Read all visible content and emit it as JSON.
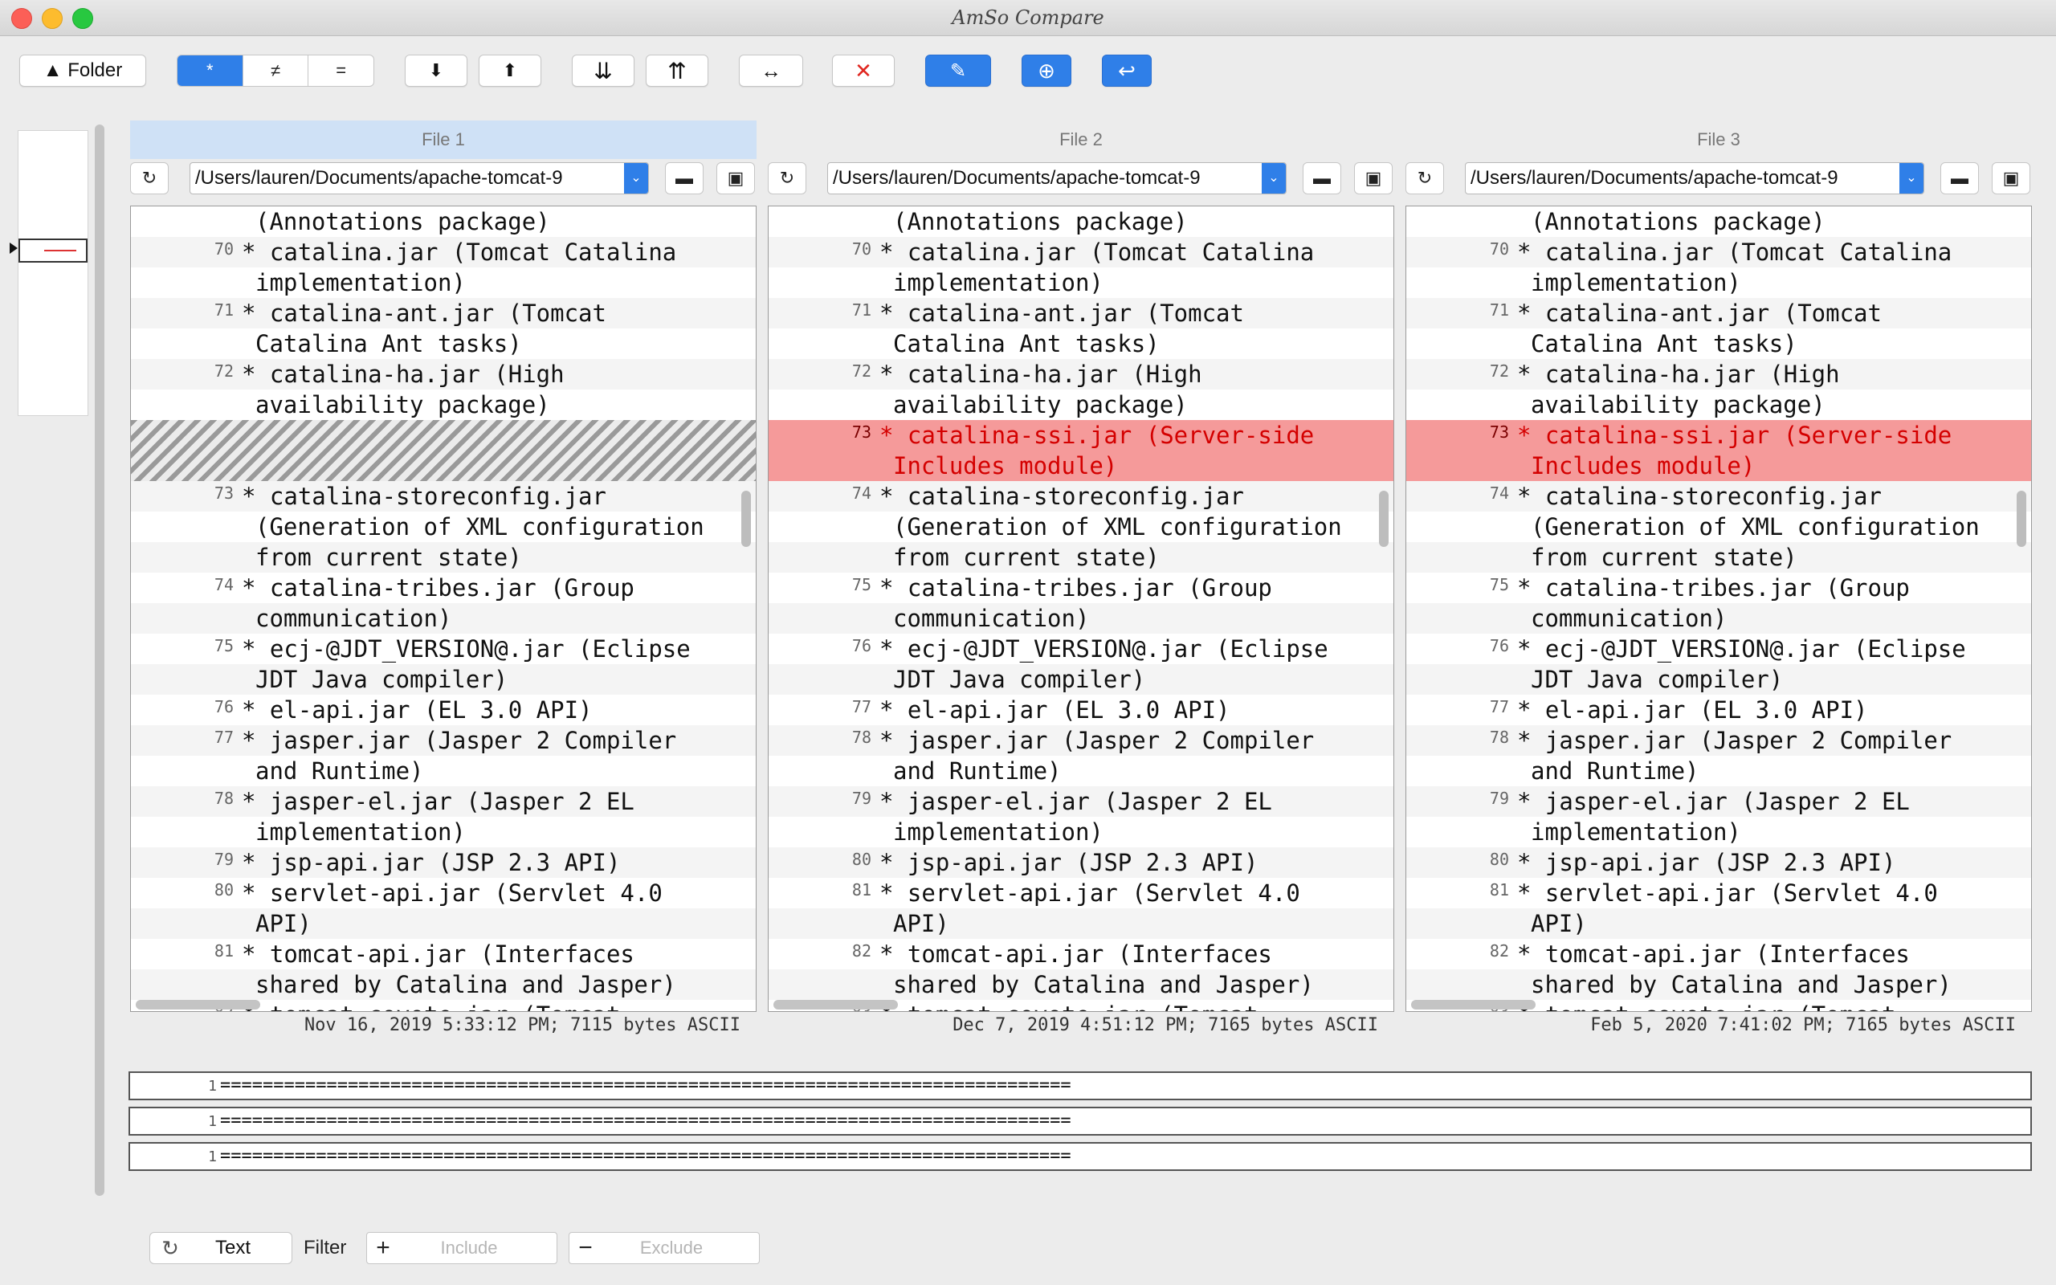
{
  "window": {
    "title": "AmSo Compare"
  },
  "toolbar": {
    "folder_label": "▲ Folder",
    "seg_all": "*",
    "seg_diff": "≠",
    "seg_equal": "=",
    "next": "⬇",
    "prev": "⬆",
    "last": "⇊",
    "first": "⇈",
    "swap": "↔",
    "close": "✕",
    "edit": "✎",
    "sync": "⊕",
    "return": "↩"
  },
  "files": [
    {
      "header": "File 1",
      "path": "/Users/lauren/Documents/apache-tomcat-9",
      "status": "Nov 16, 2019 5:33:12 PM; 7115 bytes ASCII",
      "rows": [
        {
          "ln": "",
          "text": "(Annotations package)",
          "kind": "cont"
        },
        {
          "ln": "70",
          "text": "* catalina.jar (Tomcat Catalina",
          "kind": "line"
        },
        {
          "ln": "",
          "text": "implementation)",
          "kind": "cont"
        },
        {
          "ln": "71",
          "text": "* catalina-ant.jar (Tomcat",
          "kind": "line"
        },
        {
          "ln": "",
          "text": "Catalina Ant tasks)",
          "kind": "cont"
        },
        {
          "ln": "72",
          "text": "* catalina-ha.jar (High",
          "kind": "line"
        },
        {
          "ln": "",
          "text": "availability package)",
          "kind": "cont"
        },
        {
          "ln": "",
          "text": "",
          "kind": "hatch"
        },
        {
          "ln": "73",
          "text": "* catalina-storeconfig.jar",
          "kind": "line"
        },
        {
          "ln": "",
          "text": "(Generation of XML configuration",
          "kind": "cont"
        },
        {
          "ln": "",
          "text": "from current state)",
          "kind": "cont"
        },
        {
          "ln": "74",
          "text": "* catalina-tribes.jar (Group",
          "kind": "line"
        },
        {
          "ln": "",
          "text": "communication)",
          "kind": "cont"
        },
        {
          "ln": "75",
          "text": "* ecj-@JDT_VERSION@.jar (Eclipse",
          "kind": "line"
        },
        {
          "ln": "",
          "text": "JDT Java compiler)",
          "kind": "cont"
        },
        {
          "ln": "76",
          "text": "* el-api.jar (EL 3.0 API)",
          "kind": "line"
        },
        {
          "ln": "77",
          "text": "* jasper.jar (Jasper 2 Compiler",
          "kind": "line"
        },
        {
          "ln": "",
          "text": "and Runtime)",
          "kind": "cont"
        },
        {
          "ln": "78",
          "text": "* jasper-el.jar (Jasper 2 EL",
          "kind": "line"
        },
        {
          "ln": "",
          "text": "implementation)",
          "kind": "cont"
        },
        {
          "ln": "79",
          "text": "* jsp-api.jar (JSP 2.3 API)",
          "kind": "line"
        },
        {
          "ln": "80",
          "text": "* servlet-api.jar (Servlet 4.0",
          "kind": "line"
        },
        {
          "ln": "",
          "text": "API)",
          "kind": "cont"
        },
        {
          "ln": "81",
          "text": "* tomcat-api.jar (Interfaces",
          "kind": "line"
        },
        {
          "ln": "",
          "text": "shared by Catalina and Jasper)",
          "kind": "cont"
        },
        {
          "ln": "82",
          "text": "* tomcat-coyote.jar (Tomcat",
          "kind": "line"
        }
      ]
    },
    {
      "header": "File 2",
      "path": "/Users/lauren/Documents/apache-tomcat-9",
      "status": "Dec 7, 2019 4:51:12 PM; 7165 bytes ASCII",
      "rows": [
        {
          "ln": "",
          "text": "(Annotations package)",
          "kind": "cont"
        },
        {
          "ln": "70",
          "text": "* catalina.jar (Tomcat Catalina",
          "kind": "line"
        },
        {
          "ln": "",
          "text": "implementation)",
          "kind": "cont"
        },
        {
          "ln": "71",
          "text": "* catalina-ant.jar (Tomcat",
          "kind": "line"
        },
        {
          "ln": "",
          "text": "Catalina Ant tasks)",
          "kind": "cont"
        },
        {
          "ln": "72",
          "text": "* catalina-ha.jar (High",
          "kind": "line"
        },
        {
          "ln": "",
          "text": "availability package)",
          "kind": "cont"
        },
        {
          "ln": "73",
          "text": "* catalina-ssi.jar (Server-side",
          "kind": "diff"
        },
        {
          "ln": "",
          "text": "Includes module)",
          "kind": "diffcont"
        },
        {
          "ln": "74",
          "text": "* catalina-storeconfig.jar",
          "kind": "line"
        },
        {
          "ln": "",
          "text": "(Generation of XML configuration",
          "kind": "cont"
        },
        {
          "ln": "",
          "text": "from current state)",
          "kind": "cont"
        },
        {
          "ln": "75",
          "text": "* catalina-tribes.jar (Group",
          "kind": "line"
        },
        {
          "ln": "",
          "text": "communication)",
          "kind": "cont"
        },
        {
          "ln": "76",
          "text": "* ecj-@JDT_VERSION@.jar (Eclipse",
          "kind": "line"
        },
        {
          "ln": "",
          "text": "JDT Java compiler)",
          "kind": "cont"
        },
        {
          "ln": "77",
          "text": "* el-api.jar (EL 3.0 API)",
          "kind": "line"
        },
        {
          "ln": "78",
          "text": "* jasper.jar (Jasper 2 Compiler",
          "kind": "line"
        },
        {
          "ln": "",
          "text": "and Runtime)",
          "kind": "cont"
        },
        {
          "ln": "79",
          "text": "* jasper-el.jar (Jasper 2 EL",
          "kind": "line"
        },
        {
          "ln": "",
          "text": "implementation)",
          "kind": "cont"
        },
        {
          "ln": "80",
          "text": "* jsp-api.jar (JSP 2.3 API)",
          "kind": "line"
        },
        {
          "ln": "81",
          "text": "* servlet-api.jar (Servlet 4.0",
          "kind": "line"
        },
        {
          "ln": "",
          "text": "API)",
          "kind": "cont"
        },
        {
          "ln": "82",
          "text": "* tomcat-api.jar (Interfaces",
          "kind": "line"
        },
        {
          "ln": "",
          "text": "shared by Catalina and Jasper)",
          "kind": "cont"
        },
        {
          "ln": "83",
          "text": "* tomcat-coyote.jar (Tomcat",
          "kind": "line"
        }
      ]
    },
    {
      "header": "File 3",
      "path": "/Users/lauren/Documents/apache-tomcat-9",
      "status": "Feb 5, 2020 7:41:02 PM; 7165 bytes ASCII",
      "rows": [
        {
          "ln": "",
          "text": "(Annotations package)",
          "kind": "cont"
        },
        {
          "ln": "70",
          "text": "* catalina.jar (Tomcat Catalina",
          "kind": "line"
        },
        {
          "ln": "",
          "text": "implementation)",
          "kind": "cont"
        },
        {
          "ln": "71",
          "text": "* catalina-ant.jar (Tomcat",
          "kind": "line"
        },
        {
          "ln": "",
          "text": "Catalina Ant tasks)",
          "kind": "cont"
        },
        {
          "ln": "72",
          "text": "* catalina-ha.jar (High",
          "kind": "line"
        },
        {
          "ln": "",
          "text": "availability package)",
          "kind": "cont"
        },
        {
          "ln": "73",
          "text": "* catalina-ssi.jar (Server-side",
          "kind": "diff"
        },
        {
          "ln": "",
          "text": "Includes module)",
          "kind": "diffcont"
        },
        {
          "ln": "74",
          "text": "* catalina-storeconfig.jar",
          "kind": "line"
        },
        {
          "ln": "",
          "text": "(Generation of XML configuration",
          "kind": "cont"
        },
        {
          "ln": "",
          "text": "from current state)",
          "kind": "cont"
        },
        {
          "ln": "75",
          "text": "* catalina-tribes.jar (Group",
          "kind": "line"
        },
        {
          "ln": "",
          "text": "communication)",
          "kind": "cont"
        },
        {
          "ln": "76",
          "text": "* ecj-@JDT_VERSION@.jar (Eclipse",
          "kind": "line"
        },
        {
          "ln": "",
          "text": "JDT Java compiler)",
          "kind": "cont"
        },
        {
          "ln": "77",
          "text": "* el-api.jar (EL 3.0 API)",
          "kind": "line"
        },
        {
          "ln": "78",
          "text": "* jasper.jar (Jasper 2 Compiler",
          "kind": "line"
        },
        {
          "ln": "",
          "text": "and Runtime)",
          "kind": "cont"
        },
        {
          "ln": "79",
          "text": "* jasper-el.jar (Jasper 2 EL",
          "kind": "line"
        },
        {
          "ln": "",
          "text": "implementation)",
          "kind": "cont"
        },
        {
          "ln": "80",
          "text": "* jsp-api.jar (JSP 2.3 API)",
          "kind": "line"
        },
        {
          "ln": "81",
          "text": "* servlet-api.jar (Servlet 4.0",
          "kind": "line"
        },
        {
          "ln": "",
          "text": "API)",
          "kind": "cont"
        },
        {
          "ln": "82",
          "text": "* tomcat-api.jar (Interfaces",
          "kind": "line"
        },
        {
          "ln": "",
          "text": "shared by Catalina and Jasper)",
          "kind": "cont"
        },
        {
          "ln": "83",
          "text": "* tomcat-coyote.jar (Tomcat",
          "kind": "line"
        }
      ]
    }
  ],
  "strips": [
    {
      "ln": "1",
      "text": "================================================================================"
    },
    {
      "ln": "1",
      "text": "================================================================================"
    },
    {
      "ln": "1",
      "text": "================================================================================"
    }
  ],
  "bottom": {
    "text_button": "Text",
    "filter_label": "Filter",
    "include_placeholder": "Include",
    "exclude_placeholder": "Exclude",
    "plus": "+",
    "minus": "−",
    "refresh": "↻"
  },
  "icons": {
    "refresh": "↻",
    "folder": "▬",
    "save": "▣",
    "dropdown": "⌄"
  },
  "colors": {
    "accent": "#2f7fe8",
    "diff_bg": "#f59a9a",
    "diff_text": "#d40000",
    "active_header": "#cfe1f6"
  }
}
